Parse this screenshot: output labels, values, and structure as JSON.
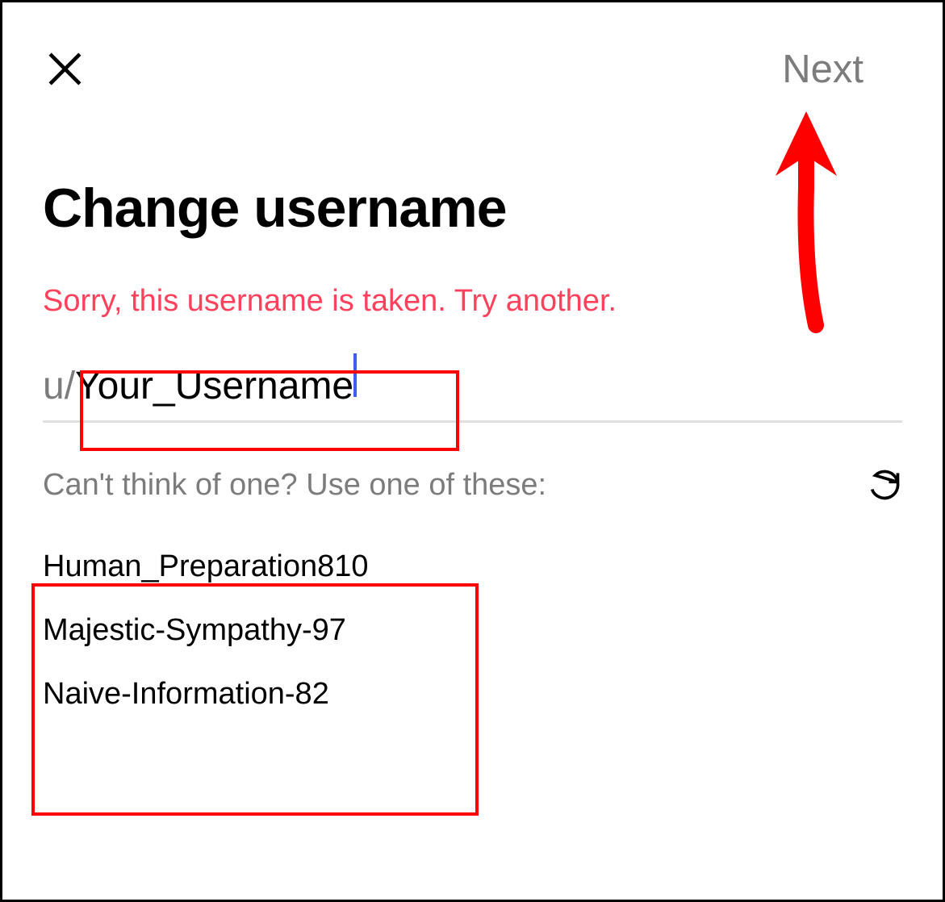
{
  "header": {
    "next_label": "Next"
  },
  "title": "Change username",
  "error_message": "Sorry, this username is taken. Try another.",
  "input": {
    "prefix": "u/",
    "value": "Your_Username"
  },
  "suggestions": {
    "label": "Can't think of one? Use one of these:",
    "items": [
      "Human_Preparation810",
      "Majestic-Sympathy-97",
      "Naive-Information-82"
    ]
  }
}
